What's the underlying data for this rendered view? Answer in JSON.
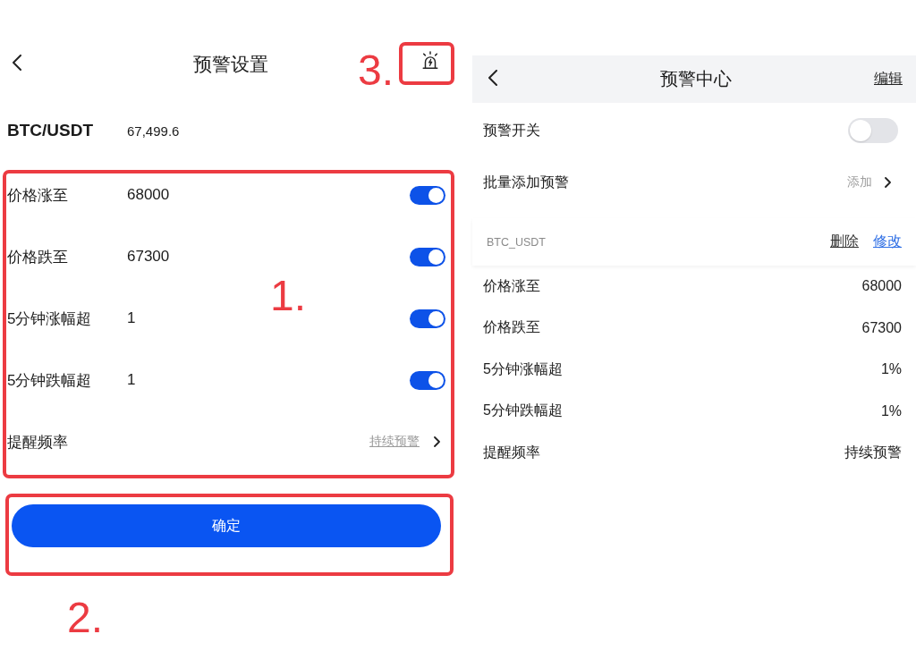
{
  "settings_screen": {
    "header": {
      "title": "预警设置",
      "alarm_annotation": "3."
    },
    "pair": {
      "symbol": "BTC/USDT",
      "price": "67,499.6"
    },
    "alerts": {
      "annotation": "1.",
      "rows": [
        {
          "kind": "toggle",
          "label": "价格涨至",
          "value": "68000",
          "on": true
        },
        {
          "kind": "toggle",
          "label": "价格跌至",
          "value": "67300",
          "on": true
        },
        {
          "kind": "toggle",
          "label": "5分钟涨幅超",
          "value": "1",
          "on": true
        },
        {
          "kind": "toggle",
          "label": "5分钟跌幅超",
          "value": "1",
          "on": true
        },
        {
          "kind": "link",
          "label": "提醒频率",
          "value": "持续预警"
        }
      ]
    },
    "confirm": {
      "annotation": "2.",
      "button": "确定"
    }
  },
  "alert_center": {
    "header": {
      "title": "预警中心",
      "action": "编辑"
    },
    "settings": [
      {
        "kind": "toggle",
        "label": "预警开关",
        "on": false
      },
      {
        "kind": "link",
        "label": "批量添加预警",
        "value": "添加"
      }
    ],
    "alert": {
      "pair": "BTC_USDT",
      "actions": [
        {
          "kind": "delete",
          "label": "删除"
        },
        {
          "kind": "edit",
          "label": "修改"
        }
      ],
      "rows": [
        {
          "label": "价格涨至",
          "value": "68000"
        },
        {
          "label": "价格跌至",
          "value": "67300"
        },
        {
          "label": "5分钟涨幅超",
          "value": "1%"
        },
        {
          "label": "5分钟跌幅超",
          "value": "1%"
        },
        {
          "label": "提醒频率",
          "value": "持续预警"
        }
      ]
    }
  }
}
